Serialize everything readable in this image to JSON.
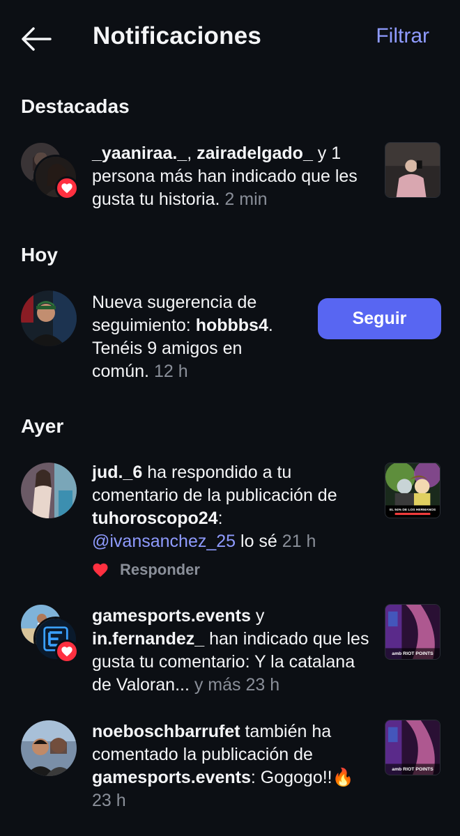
{
  "header": {
    "title": "Notificaciones",
    "filter_label": "Filtrar",
    "back_icon": "arrow-left-icon"
  },
  "sections": {
    "featured": "Destacadas",
    "today": "Hoy",
    "yesterday": "Ayer"
  },
  "notifications": {
    "story_likes": {
      "user1": "_yaaniraa._",
      "sep": ", ",
      "user2": "zairadelgado_",
      "rest": " y 1 persona más han indicado que les gusta tu historia.",
      "time": "2 min"
    },
    "suggestion": {
      "prefix": "Nueva sugerencia de seguimiento: ",
      "user": "hobbbs4",
      "rest": ". Tenéis 9 amigos en común.",
      "time": "12 h",
      "button": "Seguir"
    },
    "reply": {
      "user": "jud._6",
      "mid": " ha respondido a tu comentario de la publicación de ",
      "account": "tuhoroscopo24",
      "colon": ":",
      "mention": "@ivansanchez_25",
      "message": " lo sé",
      "time": "21 h",
      "reply_label": "Responder",
      "thumb_caption": "EL 94% DE LOS HERMANOS"
    },
    "comment_likes": {
      "user1": "gamesports.events",
      "and": " y ",
      "user2": "in.fernandez_",
      "rest": " han indicado que les gusta tu comentario: Y la catalana de Valoran...",
      "more": " y más",
      "time": "23 h",
      "thumb_caption": "amb RIOT POINTS"
    },
    "also_commented": {
      "user": "noeboschbarrufet",
      "mid": " también ha comentado la publicación de ",
      "account": "gamesports.events",
      "message": ": Gogogo!!🔥",
      "time": "23 h",
      "thumb_caption": "amb RIOT POINTS"
    }
  },
  "colors": {
    "background": "#0c0f14",
    "accent": "#8f9bff",
    "button": "#5866f2",
    "heart": "#ff3040",
    "muted": "#8a8f99"
  }
}
